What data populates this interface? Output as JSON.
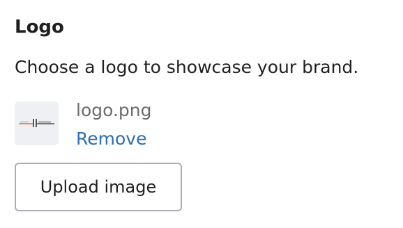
{
  "logo_section": {
    "title": "Logo",
    "description": "Choose a logo to showcase your brand.",
    "file_name": "logo.png",
    "remove_label": "Remove",
    "upload_label": "Upload image"
  },
  "colors": {
    "remove_link": "#2c6eb0",
    "thumbnail_bg": "#eef0f3",
    "button_border": "#a9aeb5"
  }
}
